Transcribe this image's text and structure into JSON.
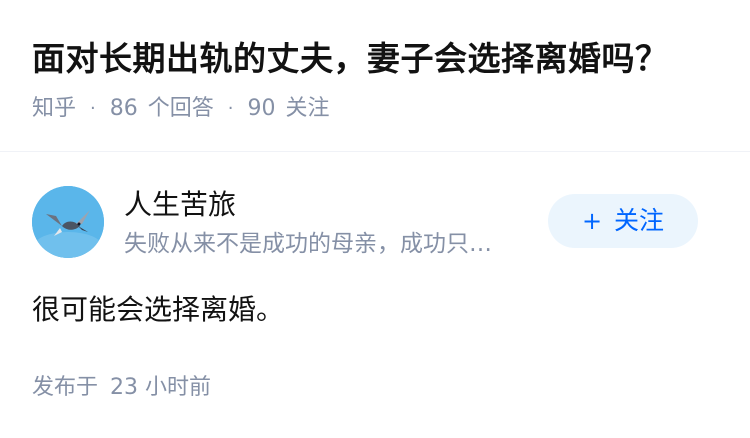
{
  "question": {
    "title": "面对长期出轨的丈夫，妻子会选择离婚吗？",
    "site": "知乎",
    "answer_count": "86",
    "answer_label": "个回答",
    "follower_count": "90",
    "follower_label": "关注"
  },
  "author": {
    "name": "人生苦旅",
    "bio": "失败从来不是成功的母亲，成功只…",
    "avatar_icon": "bird-avatar-icon",
    "follow_button_label": "关注"
  },
  "answer": {
    "content": "很可能会选择离婚。",
    "time_prefix": "发布于",
    "time_value": "23 小时前"
  },
  "colors": {
    "title": "#121212",
    "meta": "#8590a6",
    "accent": "#0066ff",
    "follow_bg": "#ebf5fd",
    "avatar_bg": "#5ab6ea"
  }
}
